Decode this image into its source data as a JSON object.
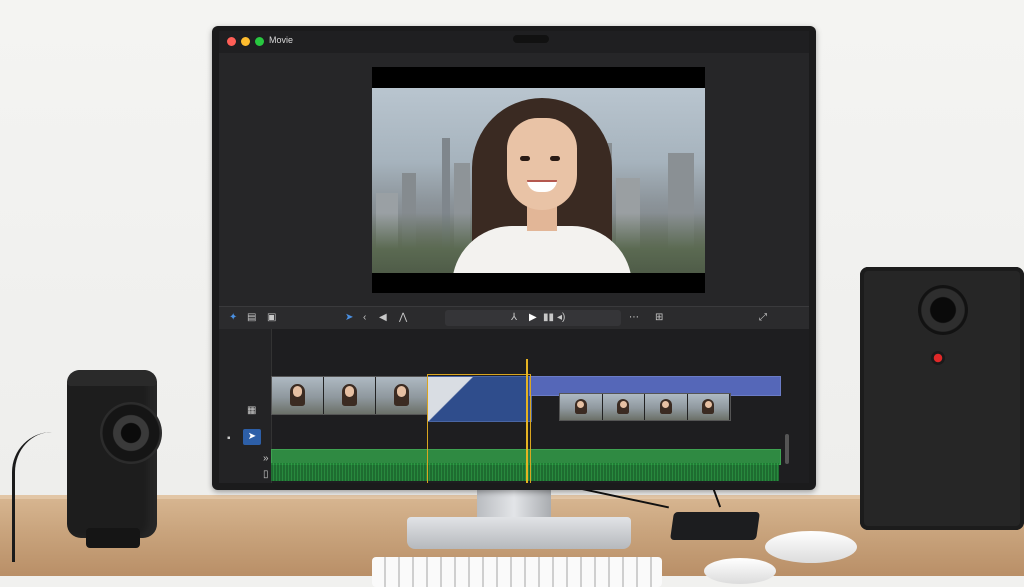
{
  "app": {
    "title": "Movie",
    "window_controls": [
      "close",
      "minimize",
      "maximize"
    ]
  },
  "toolbar": {
    "left_icons": [
      "magic-wand-icon",
      "library-icon",
      "media-browser-icon"
    ],
    "edit_tools": [
      "select-arrow-icon",
      "trim-icon",
      "back-icon",
      "audio-icon"
    ],
    "transport": [
      "skip-back-icon",
      "play-icon",
      "pause-frames-icon",
      "volume-icon"
    ],
    "right_icons": [
      "more-icon",
      "share-icon",
      "fullscreen-icon"
    ]
  },
  "timeline": {
    "selected_tool": "select-arrow-icon",
    "thumb_count_left": 3,
    "thumb_count_right": 4
  },
  "colors": {
    "video_clip": "#5567b8",
    "audio_track": "#2f8a42",
    "playhead": "#e6b422",
    "accent": "#4a90e2"
  }
}
